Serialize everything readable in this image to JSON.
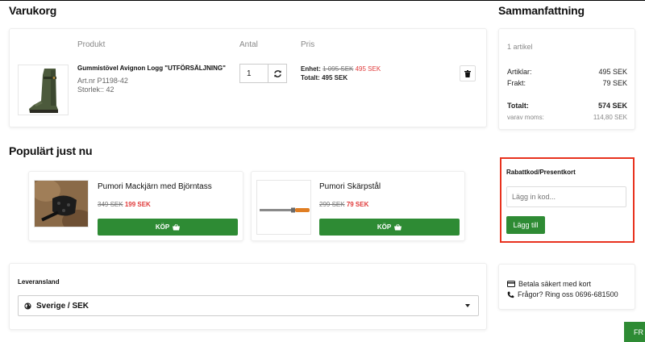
{
  "cart": {
    "title": "Varukorg",
    "col_product": "Produkt",
    "col_qty": "Antal",
    "col_price": "Pris",
    "item": {
      "name": "Gummistövel Avignon Logg \"UTFÖRSÄLJNING\"",
      "art_nr": "Art.nr P1198-42",
      "size": "Storlek:: 42",
      "qty": "1",
      "unit_label": "Enhet:",
      "unit_old": "1 095 SEK",
      "unit_new": "495 SEK",
      "total_label": "Totalt:",
      "total_value": "495 SEK"
    }
  },
  "popular": {
    "title": "Populärt just nu",
    "products": [
      {
        "name": "Pumori Mackjärn med Björntass",
        "old_price": "349 SEK",
        "new_price": "199 SEK",
        "buy_label": "KÖP"
      },
      {
        "name": "Pumori Skärpstål",
        "old_price": "299 SEK",
        "new_price": "79 SEK",
        "buy_label": "KÖP"
      }
    ]
  },
  "delivery": {
    "label": "Leveransland",
    "selected": "Sverige / SEK"
  },
  "summary": {
    "title": "Sammanfattning",
    "count": "1 artikel",
    "articles_label": "Artiklar:",
    "articles_value": "495 SEK",
    "shipping_label": "Frakt:",
    "shipping_value": "79 SEK",
    "total_label": "Totalt:",
    "total_value": "574 SEK",
    "vat_label": "varav moms:",
    "vat_value": "114,80 SEK"
  },
  "discount": {
    "title": "Rabattkod/Presentkort",
    "placeholder": "Lägg in kod...",
    "apply_label": "Lägg till"
  },
  "info": {
    "secure_pay": "Betala säkert med kort",
    "phone": "Frågor? Ring oss 0696-681500"
  },
  "corner_button": "FR",
  "colors": {
    "green": "#2e8b34",
    "sale_red": "#e03a3a",
    "highlight_red": "#e8321e"
  }
}
